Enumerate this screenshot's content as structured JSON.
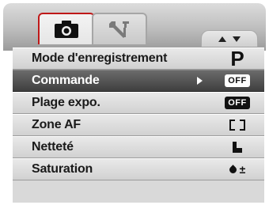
{
  "header": {
    "tabs": [
      {
        "name": "camera",
        "icon": "camera-icon",
        "active": true
      },
      {
        "name": "setup",
        "icon": "wrench-icon",
        "active": false
      }
    ],
    "nav_icons": [
      "up-arrow-icon",
      "down-arrow-icon"
    ]
  },
  "menu": {
    "selected_index": 1,
    "items": [
      {
        "label": "Mode d'enregistrement",
        "value": "P",
        "icon": "program-mode-icon"
      },
      {
        "label": "Commande",
        "value": "OFF",
        "icon": "off-badge-icon",
        "has_submenu": true
      },
      {
        "label": "Plage expo.",
        "value": "OFF",
        "icon": "off-badge-icon"
      },
      {
        "label": "Zone AF",
        "icon": "af-frame-icon"
      },
      {
        "label": "Netteté",
        "icon": "sharpness-icon"
      },
      {
        "label": "Saturation",
        "value": "±",
        "icon": "saturation-icon"
      }
    ]
  },
  "colors": {
    "accent_red": "#bf1818",
    "selected_row": "#4a4a4a",
    "row_bg": "#dedede"
  }
}
